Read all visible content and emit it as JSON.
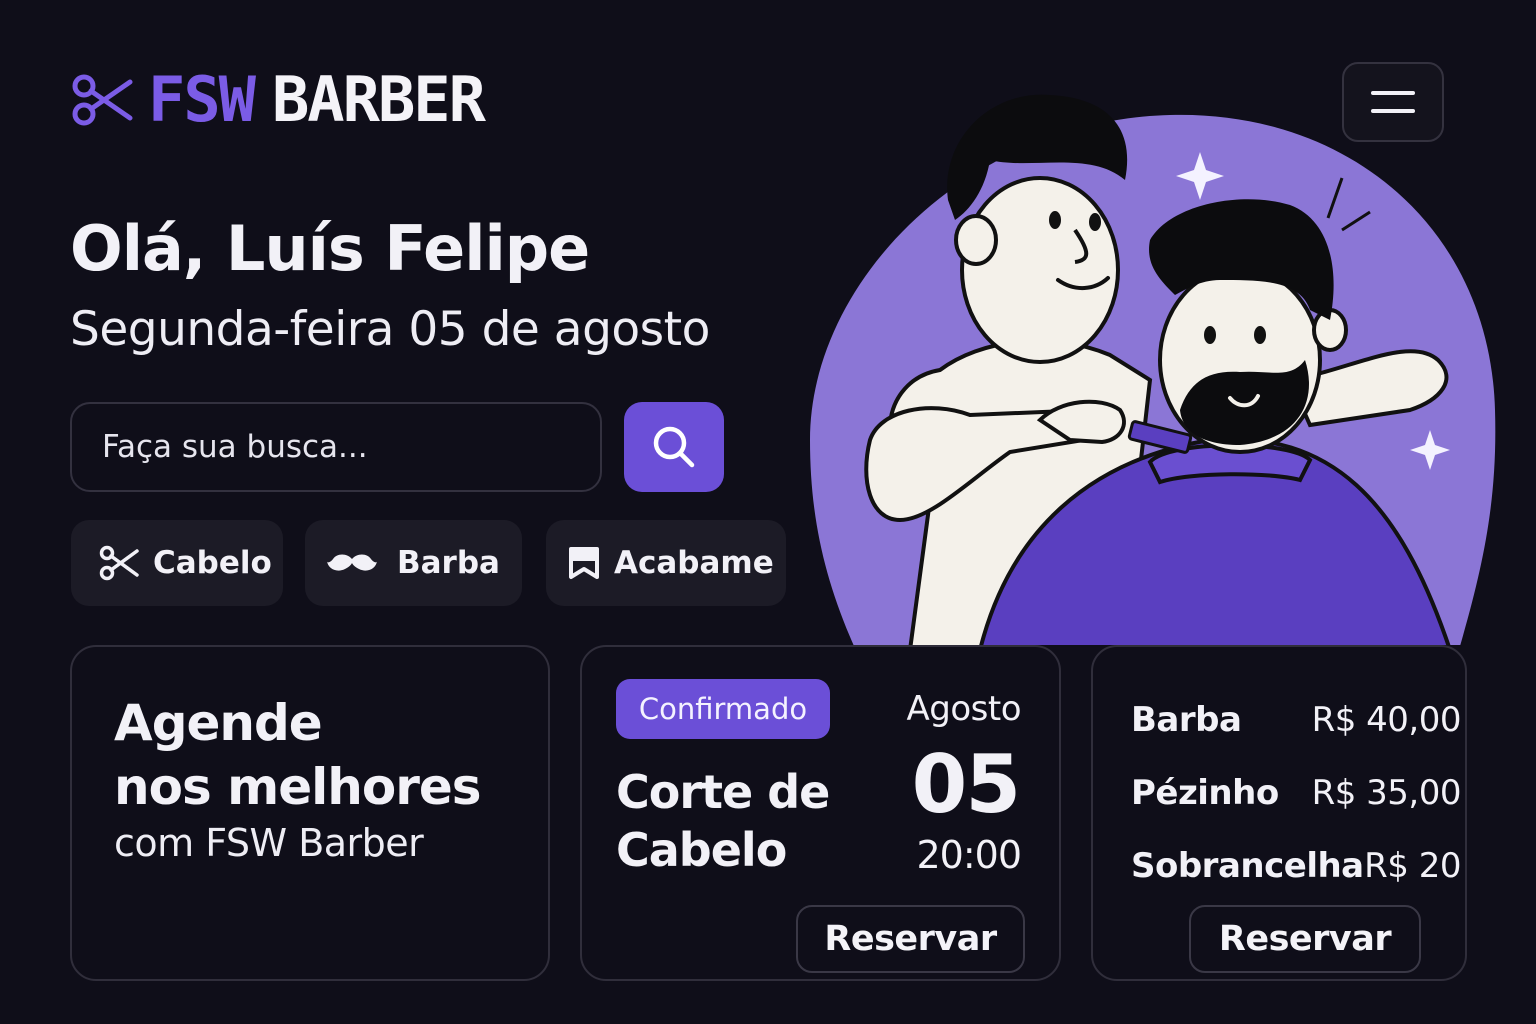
{
  "header": {
    "logo_brand": "FSW",
    "logo_name": "BARBER",
    "logo_icon": "scissors-icon",
    "menu_icon": "hamburger-menu-icon"
  },
  "greeting": {
    "title": "Olá, Luís Felipe",
    "date": "Segunda-feira 05 de agosto"
  },
  "search": {
    "placeholder": "Faça sua busca...",
    "button_icon": "search-icon"
  },
  "categories": [
    {
      "label": "Cabelo",
      "icon": "scissors-icon"
    },
    {
      "label": "Barba",
      "icon": "mustache-icon"
    },
    {
      "label": "Acabame",
      "icon": "bookmark-icon"
    }
  ],
  "promo": {
    "title_line1": "Agende",
    "title_line2": "nos melhores",
    "subtitle": "com FSW Barber"
  },
  "booking": {
    "status": "Confirmado",
    "service_line1": "Corte de",
    "service_line2": "Cabelo",
    "month": "Agosto",
    "day": "05",
    "time": "20:00",
    "button": "Reservar"
  },
  "prices": {
    "items": [
      {
        "name": "Barba",
        "price": "R$ 40,00"
      },
      {
        "name": "Pézinho",
        "price": "R$ 35,00"
      },
      {
        "name": "Sobrancelha",
        "price": "R$ 20"
      }
    ],
    "button": "Reservar"
  },
  "colors": {
    "background": "#0f0e19",
    "accent": "#6b4fd7",
    "brand": "#7b5ce6",
    "surface": "#1c1b26"
  }
}
